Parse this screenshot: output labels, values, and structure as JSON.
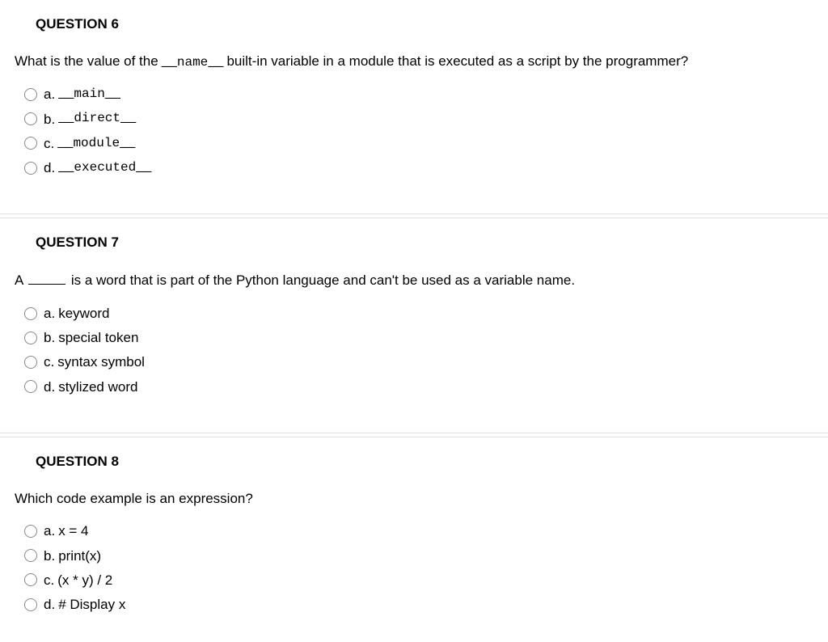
{
  "q6": {
    "header": "QUESTION 6",
    "prompt_pre": "What is the value of the ",
    "prompt_code_pre": "__",
    "prompt_code_mid": "name",
    "prompt_code_post": "__",
    "prompt_post": " built-in variable in a module that is executed as a script by the programmer?",
    "options": [
      {
        "letter": "a.",
        "pre": "__",
        "mid": "main",
        "post": "__"
      },
      {
        "letter": "b.",
        "pre": "__",
        "mid": "direct",
        "post": "__"
      },
      {
        "letter": "c.",
        "pre": "__",
        "mid": "module",
        "post": "__"
      },
      {
        "letter": "d.",
        "pre": "__",
        "mid": "executed",
        "post": "__"
      }
    ]
  },
  "q7": {
    "header": "QUESTION 7",
    "prompt_pre": "A ",
    "prompt_post": " is a word that is part of the Python language and can't be used as a variable name.",
    "options": [
      {
        "letter": "a.",
        "text": "keyword"
      },
      {
        "letter": "b.",
        "text": "special token"
      },
      {
        "letter": "c.",
        "text": "syntax symbol"
      },
      {
        "letter": "d.",
        "text": "stylized word"
      }
    ]
  },
  "q8": {
    "header": "QUESTION 8",
    "prompt": "Which code example is an expression?",
    "options": [
      {
        "letter": "a.",
        "text": "x = 4"
      },
      {
        "letter": "b.",
        "text": "print(x)"
      },
      {
        "letter": "c.",
        "text": "(x * y) / 2"
      },
      {
        "letter": "d.",
        "text": "# Display x"
      }
    ]
  }
}
